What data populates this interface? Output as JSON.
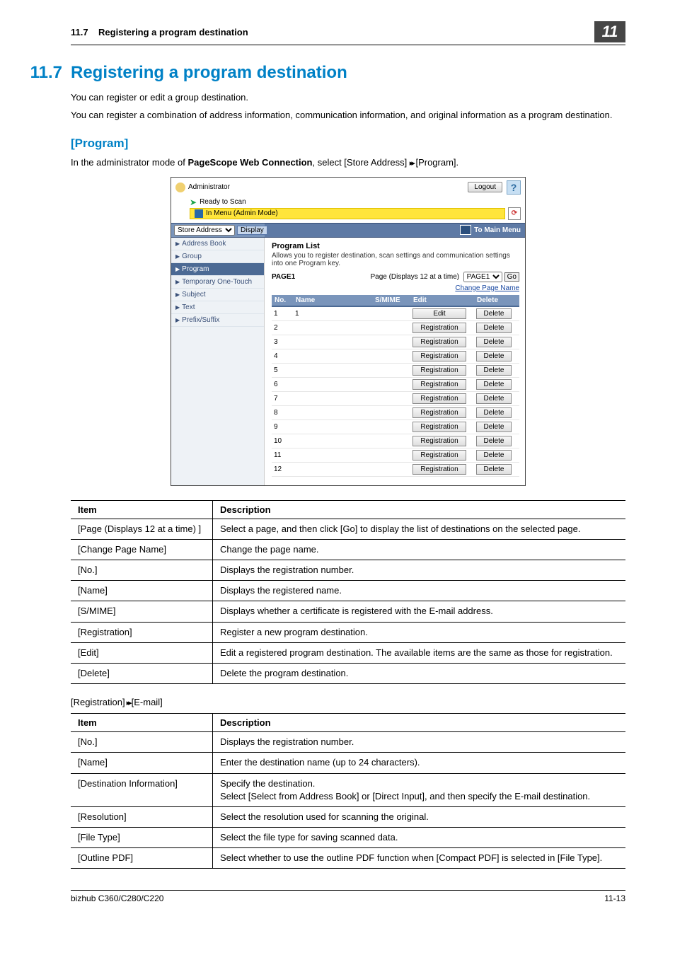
{
  "header": {
    "section_ref": "11.7",
    "section_title_text": "Registering a program destination",
    "chapter_badge": "11"
  },
  "title": {
    "number": "11.7",
    "text": "Registering a program destination"
  },
  "intro": {
    "p1": "You can register or edit a group destination.",
    "p2": "You can register a combination of address information, communication information, and original information as a program destination."
  },
  "subhead": "[Program]",
  "lead_in": {
    "prefix": "In the administrator mode of ",
    "bold": "PageScope Web Connection",
    "suffix": ", select [Store Address] ",
    "tail": " [Program]."
  },
  "screenshot": {
    "admin_label": "Administrator",
    "logout_label": "Logout",
    "help_symbol": "?",
    "ready_label": "Ready to Scan",
    "mode_label": "In Menu (Admin Mode)",
    "store_select": "Store Address",
    "display_btn": "Display",
    "to_main_menu": "To Main Menu",
    "sidebar": [
      "Address Book",
      "Group",
      "Program",
      "Temporary One-Touch",
      "Subject",
      "Text",
      "Prefix/Suffix"
    ],
    "content_title": "Program List",
    "content_desc": "Allows you to register destination, scan settings and communication settings into one Program key.",
    "page_label": "PAGE1",
    "page_at_time": "Page (Displays 12 at a time)",
    "page_select": "PAGE1",
    "go_label": "Go",
    "change_page": "Change Page Name",
    "th_no": "No.",
    "th_name": "Name",
    "th_smime": "S/MIME",
    "th_edit": "Edit",
    "th_delete": "Delete",
    "edit_label": "Edit",
    "registration_label": "Registration",
    "delete_label": "Delete",
    "row_count": 12,
    "first_row_name": "1"
  },
  "table1": {
    "h_item": "Item",
    "h_desc": "Description",
    "rows": [
      {
        "item": "[Page (Displays 12 at a time) ]",
        "desc": "Select a page, and then click [Go] to display the list of destinations on the selected page."
      },
      {
        "item": "[Change Page Name]",
        "desc": "Change the page name."
      },
      {
        "item": "[No.]",
        "desc": "Displays the registration number."
      },
      {
        "item": "[Name]",
        "desc": "Displays the registered name."
      },
      {
        "item": "[S/MIME]",
        "desc": "Displays whether a certificate is registered with the E-mail address."
      },
      {
        "item": "[Registration]",
        "desc": "Register a new program destination."
      },
      {
        "item": "[Edit]",
        "desc": "Edit a registered program destination. The available items are the same as those for registration."
      },
      {
        "item": "[Delete]",
        "desc": "Delete the program destination."
      }
    ]
  },
  "chain": {
    "left": "[Registration]",
    "right": "[E-mail]"
  },
  "table2": {
    "h_item": "Item",
    "h_desc": "Description",
    "rows": [
      {
        "item": "[No.]",
        "desc": "Displays the registration number."
      },
      {
        "item": "[Name]",
        "desc": "Enter the destination name (up to 24 characters)."
      },
      {
        "item": "[Destination Information]",
        "desc": "Specify the destination.\nSelect [Select from Address Book] or [Direct Input], and then specify the E-mail destination."
      },
      {
        "item": "[Resolution]",
        "desc": "Select the resolution used for scanning the original."
      },
      {
        "item": "[File Type]",
        "desc": "Select the file type for saving scanned data."
      },
      {
        "item": "[Outline PDF]",
        "desc": "Select whether to use the outline PDF function when [Compact PDF] is selected in [File Type]."
      }
    ]
  },
  "footer": {
    "left": "bizhub C360/C280/C220",
    "right": "11-13"
  }
}
